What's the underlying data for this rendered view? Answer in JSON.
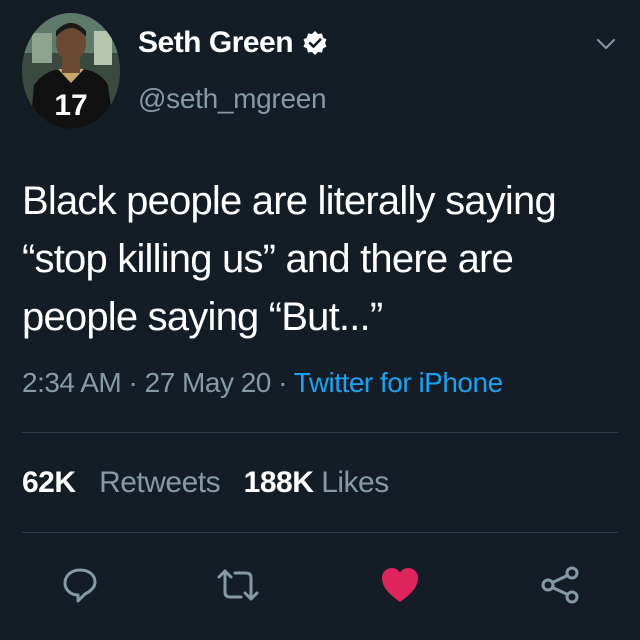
{
  "user": {
    "display_name": "Seth Green",
    "handle": "@seth_mgreen",
    "verified": true
  },
  "tweet": {
    "text_lines": [
      "Black people are literally saying",
      "“stop killing us” and there are",
      "people saying “But...”"
    ],
    "time": "2:34 AM",
    "date": "27 May 20",
    "source": "Twitter for iPhone",
    "separator": "·"
  },
  "stats": {
    "retweets_count": "62K",
    "retweets_label": "Retweets",
    "likes_count": "188K",
    "likes_label": "Likes"
  },
  "actions": [
    "reply-icon",
    "retweet-icon",
    "like-icon",
    "share-icon"
  ],
  "colors": {
    "background": "#141d26",
    "text": "#ffffff",
    "secondary_text": "#8899a6",
    "link": "#1da1f2",
    "like": "#e0245e"
  }
}
